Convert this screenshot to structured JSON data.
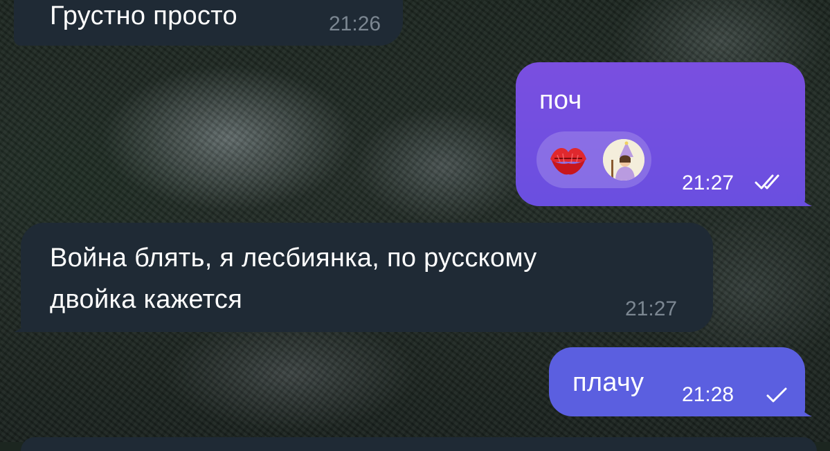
{
  "messages": [
    {
      "side": "incoming",
      "text": "Грустно просто",
      "time": "21:26"
    },
    {
      "side": "outgoing",
      "text": "поч",
      "time": "21:27",
      "status": "double-check-read",
      "reactions": [
        {
          "emoji": "kiss-mark-icon"
        },
        {
          "user_avatar": "wizard-avatar"
        }
      ]
    },
    {
      "side": "incoming",
      "lines": [
        "Война блять, я лесбиянка, по русскому",
        "двойка кажется"
      ],
      "time": "21:27"
    },
    {
      "side": "outgoing",
      "text": "плачу",
      "time": "21:28",
      "status": "single-check-sent"
    }
  ],
  "colors": {
    "incoming_bubble": "#1f2a35",
    "outgoing_bubble_purple": "#7a4fe0",
    "outgoing_bubble_blue": "#5b5fe0",
    "incoming_time": "#7c8792",
    "text": "#ffffff"
  }
}
